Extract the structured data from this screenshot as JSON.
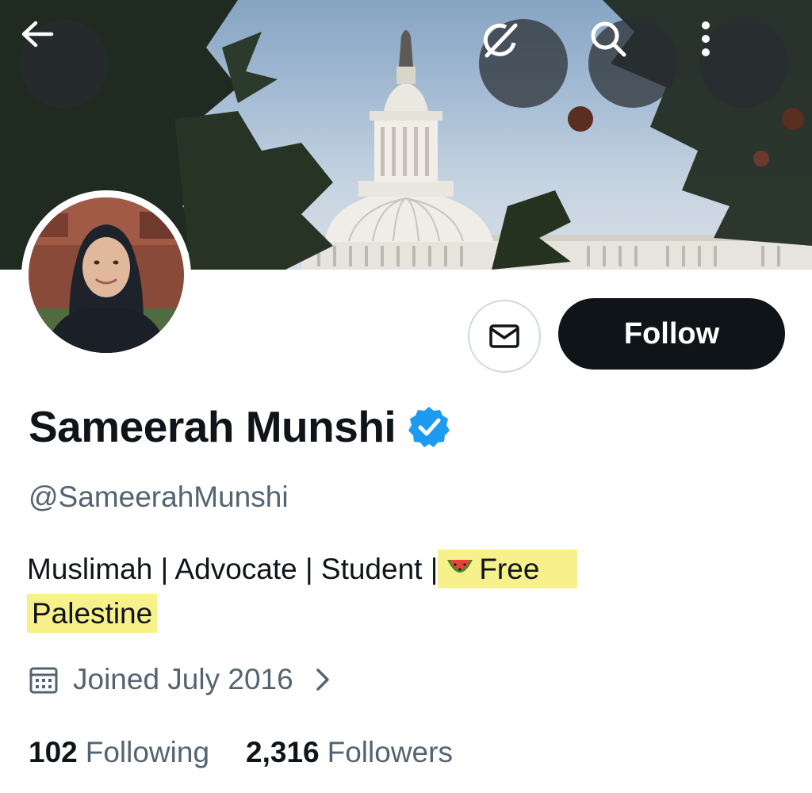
{
  "profile": {
    "display_name": "Sameerah Munshi",
    "handle": "@SameerahMunshi",
    "verified": true,
    "bio": {
      "part1": "Muslimah | Advocate | Student |",
      "highlight_line1": "Free",
      "highlight_line2": "Palestine",
      "emoji": "watermelon-emoji"
    },
    "joined": "Joined July 2016",
    "stats": {
      "following_count": "102",
      "following_label": "Following",
      "followers_count": "2,316",
      "followers_label": "Followers"
    }
  },
  "actions": {
    "follow_label": "Follow"
  },
  "icons": {
    "back": "arrow-left-icon",
    "grok": "grok-icon",
    "search": "search-icon",
    "more": "more-vertical-icon",
    "message": "envelope-icon",
    "verified": "verified-badge-icon",
    "calendar": "calendar-icon",
    "chevron": "chevron-right-icon"
  },
  "colors": {
    "text_primary": "#0f1419",
    "text_secondary": "#536471",
    "verified_blue": "#1d9bf0",
    "highlight": "#f8f08a",
    "follow_bg": "#0f1419"
  }
}
